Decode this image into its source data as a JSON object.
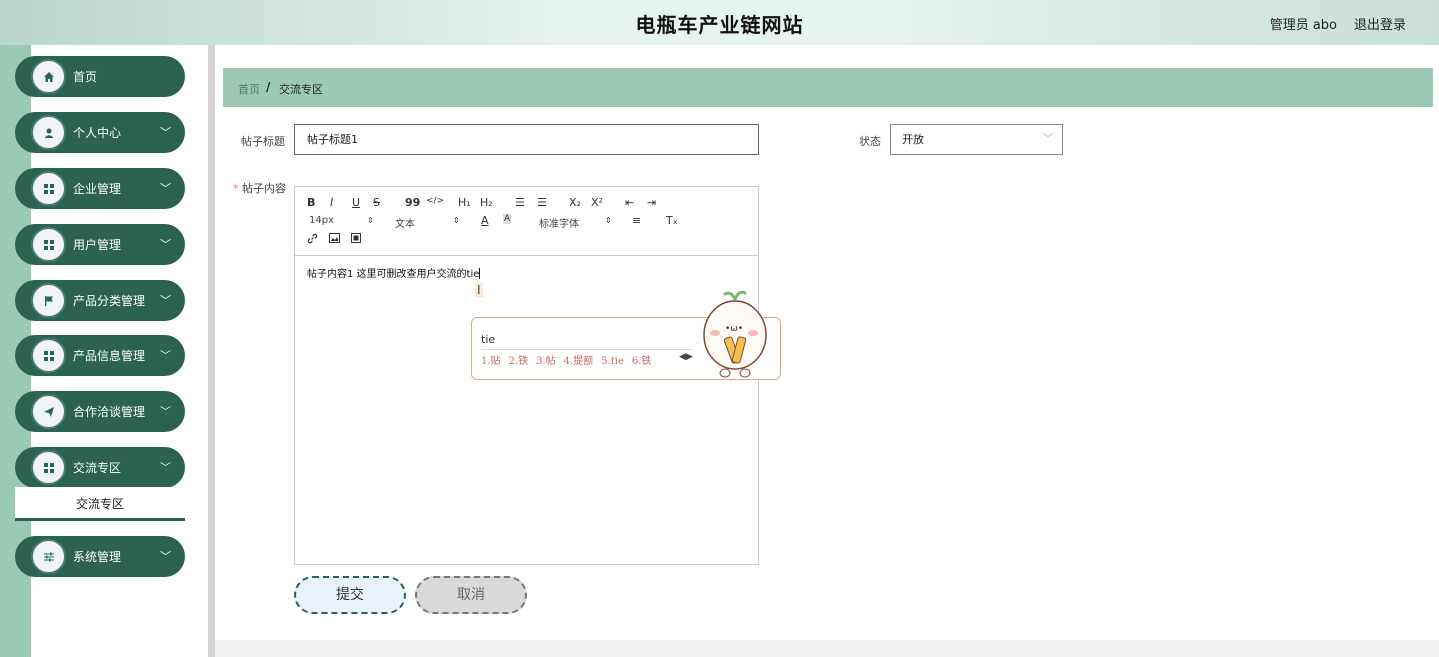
{
  "header": {
    "title": "电瓶车产业链网站",
    "user": "管理员 abo",
    "logout": "退出登录"
  },
  "sidebar": {
    "items": [
      {
        "label": "首页",
        "icon": "home-icon",
        "has_arrow": false
      },
      {
        "label": "个人中心",
        "icon": "user-icon",
        "has_arrow": true
      },
      {
        "label": "企业管理",
        "icon": "grid-icon",
        "has_arrow": true
      },
      {
        "label": "用户管理",
        "icon": "grid-icon",
        "has_arrow": true
      },
      {
        "label": "产品分类管理",
        "icon": "flag-icon",
        "has_arrow": true
      },
      {
        "label": "产品信息管理",
        "icon": "grid-icon",
        "has_arrow": true
      },
      {
        "label": "合作洽谈管理",
        "icon": "send-icon",
        "has_arrow": true
      },
      {
        "label": "交流专区",
        "icon": "grid-icon",
        "has_arrow": true
      },
      {
        "label": "系统管理",
        "icon": "sliders-icon",
        "has_arrow": true
      }
    ],
    "submenu": {
      "label": "交流专区"
    }
  },
  "breadcrumb": {
    "home": "首页",
    "separator": "/",
    "current": "交流专区"
  },
  "form": {
    "title_label": "帖子标题",
    "title_value": "帖子标题1",
    "status_label": "状态",
    "status_value": "开放",
    "content_label": "帖子内容",
    "required_mark": "*",
    "content_text": "帖子内容1 这里可删改查用户交流的tie"
  },
  "toolbar": {
    "bold": "B",
    "italic": "I",
    "underline": "U",
    "strike": "S",
    "quote": "99",
    "code": "</>",
    "h1": "H₁",
    "h2": "H₂",
    "ordered": "☰",
    "bullet": "☰",
    "sub": "X₂",
    "sup": "X²",
    "outdent": "⇤",
    "indent": "⇥",
    "size": "14px",
    "format": "文本",
    "font": "标准字体",
    "align": "≡",
    "clear": "Tₓ",
    "link": "🔗",
    "image": "▣",
    "video": "▤"
  },
  "ime": {
    "input": "tie",
    "candidates": [
      "1.贴",
      "2.铁",
      "3.帖",
      "4.提额",
      "5.tie",
      "6.铁"
    ],
    "nav": "◀▶"
  },
  "buttons": {
    "submit": "提交",
    "cancel": "取消"
  },
  "colors": {
    "menu_bg": "#2b6350",
    "accent": "#9cc9b6",
    "required": "#f56c6c"
  }
}
